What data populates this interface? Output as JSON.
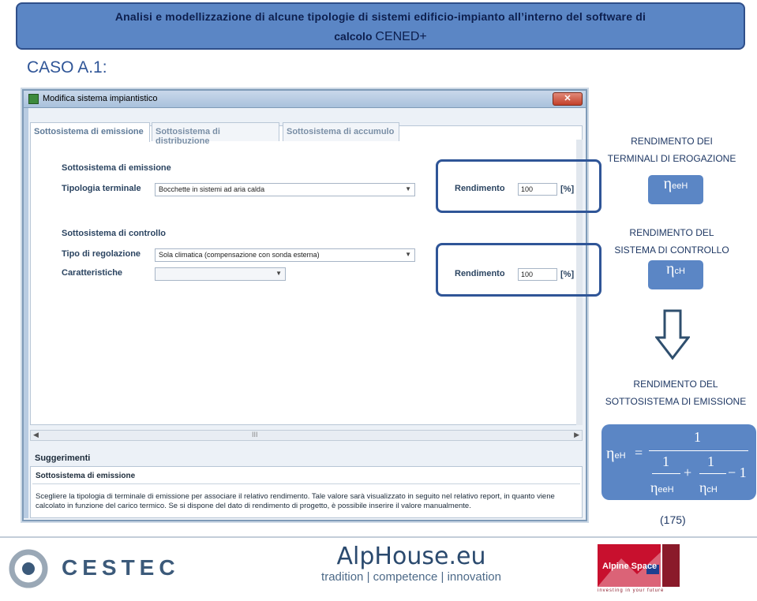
{
  "banner": {
    "line1": "Analisi e modellizzazione di alcune tipologie di sistemi edificio-impianto all’interno del software di",
    "line2_small": "calcolo ",
    "line2_big": "CENED+"
  },
  "caso": "CASO A.1:",
  "window": {
    "title": "Modifica sistema impiantistico",
    "close_label": "✕",
    "tabs": [
      "Sottosistema di emissione",
      "Sottosistema di distribuzione",
      "Sottosistema di accumulo"
    ],
    "section1": {
      "heading": "Sottosistema di emissione",
      "field_label": "Tipologia terminale",
      "select_value": "Bocchette in sistemi ad aria calda",
      "rend_label": "Rendimento",
      "rend_value": "100",
      "unit": "[%]"
    },
    "section2": {
      "heading": "Sottosistema di controllo",
      "field_label": "Tipo di regolazione",
      "select_value": "Sola climatica  (compensazione con sonda esterna)",
      "char_label": "Caratteristiche",
      "rend_label": "Rendimento",
      "rend_value": "100",
      "unit": "[%]"
    },
    "scroll_grip": "III",
    "suggestions_title": "Suggerimenti",
    "tips_heading": "Sottosistema di emissione",
    "tips_text": "Scegliere la tipologia di terminale di emissione per associare il relativo rendimento. Tale valore sarà visualizzato in seguito nel relativo report, in quanto viene calcolato in funzione del carico termico. Se si dispone del dato di rendimento di progetto, è possibile inserire il valore manualmente."
  },
  "right": {
    "cap1_l1": "RENDIMENTO DEI",
    "cap1_l2": "TERMINALI DI EROGAZIONE",
    "badge1_eta": "η",
    "badge1_sub": "eeH",
    "cap2_l1": "RENDIMENTO DEL",
    "cap2_l2": "SISTEMA DI CONTROLLO",
    "badge2_eta": "η",
    "badge2_sub": "cH",
    "cap3_l1": "RENDIMENTO DEL",
    "cap3_l2": "SOTTOSISTEMA DI EMISSIONE",
    "formula": {
      "lhs_eta": "η",
      "lhs_sub": "eH",
      "eq": "=",
      "num": "1",
      "one_a": "1",
      "one_b": "1",
      "plus": "+",
      "minus1": "− 1",
      "den_a_eta": "η",
      "den_a_sub": "eeH",
      "den_b_eta": "η",
      "den_b_sub": "cH"
    },
    "eq_number": "(175)"
  },
  "footer": {
    "cestec": "CESTEC",
    "alphouse": "AlpHouse.eu",
    "alphouse_sub": "tradition | competence | innovation",
    "alpine": "Alpine Space",
    "alpine_sub": "investing in your future"
  },
  "colors": {
    "banner_bg": "#5b86c5",
    "highlight": "#2f5597",
    "text_blue": "#1f3864"
  }
}
